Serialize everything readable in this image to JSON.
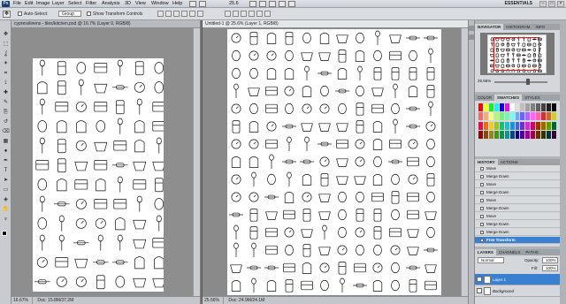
{
  "menubar": {
    "logo": "Ps",
    "items": [
      "File",
      "Edit",
      "Image",
      "Layer",
      "Select",
      "Filter",
      "Analysis",
      "3D",
      "View",
      "Window",
      "Help"
    ],
    "zoom": "25.6",
    "workspace": "ESSENTIALS",
    "window_controls": [
      "–",
      "□",
      "×"
    ]
  },
  "options_bar": {
    "auto_select": "Auto-Select:",
    "auto_select_value": "Group",
    "show_transform": "Show Transform Controls"
  },
  "toolbox": {
    "tools": [
      "move-tool",
      "marquee-tool",
      "lasso-tool",
      "magic-wand-tool",
      "crop-tool",
      "eyedropper-tool",
      "healing-tool",
      "brush-tool",
      "clone-tool",
      "history-brush-tool",
      "eraser-tool",
      "gradient-tool",
      "dodge-tool",
      "pen-tool",
      "type-tool",
      "path-select-tool",
      "shape-tool",
      "3d-tool",
      "hand-tool",
      "zoom-tool"
    ]
  },
  "doc_left": {
    "tab": "cypresslinens - tiles/kitchen.psd @ 16.7% (Layer 0, RGB/8)",
    "zoom": "16.67%",
    "status": "Doc: 15.8M/37.2M"
  },
  "doc_right": {
    "tab": "Untitled-1 @ 25.6% (Layer 1, RGB/8)",
    "zoom": "25.56%",
    "status": "Doc: 24.9M/24.1M"
  },
  "navigator": {
    "tabs": [
      "NAVIGATOR",
      "HISTOGRAM",
      "INFO"
    ],
    "zoom": "25.56%"
  },
  "swatches": {
    "tabs": [
      "COLOR",
      "SWATCHES",
      "STYLES"
    ],
    "colors": [
      "#ff0000",
      "#ffff00",
      "#00ff00",
      "#00ffff",
      "#0000ff",
      "#ff00ff",
      "#ffffff",
      "#e0e0e0",
      "#c0c0c0",
      "#a0a0a0",
      "#808080",
      "#606060",
      "#404040",
      "#202020",
      "#000000",
      "#ff6666",
      "#ffaa66",
      "#ffff66",
      "#aaff66",
      "#66ff66",
      "#66ffaa",
      "#66ffff",
      "#66aaff",
      "#6666ff",
      "#aa66ff",
      "#ff66ff",
      "#ff66aa",
      "#cc3333",
      "#cc6633",
      "#cccc33",
      "#ff0044",
      "#ff6600",
      "#ffcc00",
      "#99cc00",
      "#00cc66",
      "#00cccc",
      "#0099ff",
      "#3366ff",
      "#6633cc",
      "#cc33cc",
      "#cc0066",
      "#993300",
      "#996600",
      "#669900",
      "#006633",
      "#990000",
      "#994400",
      "#998800",
      "#449900",
      "#009944",
      "#009999",
      "#004499",
      "#000099",
      "#440099",
      "#990099",
      "#990044",
      "#663300",
      "#333300",
      "#003333",
      "#330033"
    ]
  },
  "history": {
    "tabs": [
      "HISTORY",
      "ACTIONS"
    ],
    "items": [
      "Move",
      "Merge Down",
      "Move",
      "Merge Down",
      "Move",
      "Merge Down",
      "Move",
      "Merge Down",
      "Merge Down",
      "Free Transform"
    ]
  },
  "layers": {
    "tabs": [
      "LAYERS",
      "CHANNELS",
      "PATHS"
    ],
    "blend_mode": "Normal",
    "opacity_label": "Opacity:",
    "opacity": "100%",
    "fill_label": "Fill:",
    "fill": "100%",
    "items": [
      "Layer 1",
      "Background"
    ]
  }
}
